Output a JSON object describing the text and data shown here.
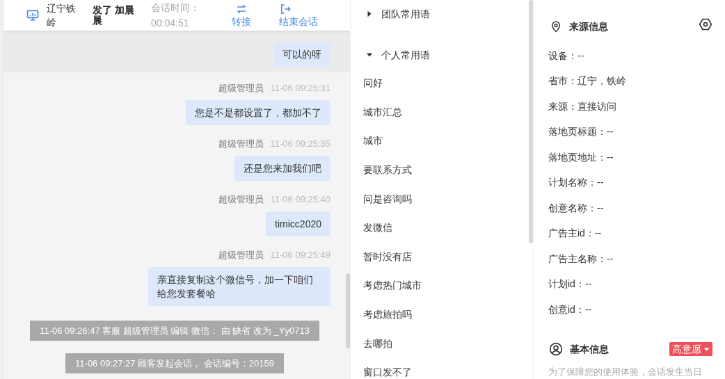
{
  "header": {
    "location": "辽宁铁岭",
    "visitor": "发了 加晨晨",
    "duration_label": "会话时间：",
    "duration": "00:04:51",
    "actions": [
      {
        "kind": "transfer",
        "label": "转接"
      },
      {
        "kind": "end",
        "label": "结束会话"
      }
    ]
  },
  "chat": {
    "messages": [
      {
        "kind": "bubble",
        "highlighted": true,
        "text": "可以的呀"
      },
      {
        "kind": "bubble",
        "highlighted": false,
        "sender": "超级管理员",
        "time": "11-06 09:25:31",
        "text": "您是不是都设置了，都加不了"
      },
      {
        "kind": "bubble",
        "highlighted": false,
        "sender": "超级管理员",
        "time": "11-06 09:25:35",
        "text": "还是您来加我们吧"
      },
      {
        "kind": "bubble",
        "highlighted": false,
        "sender": "超级管理员",
        "time": "11-06 09:25:40",
        "text": "timicc2020"
      },
      {
        "kind": "bubble",
        "highlighted": false,
        "sender": "超级管理员",
        "time": "11-06 09:25:49",
        "text": "亲直接复制这个微信号，加一下咱们给您发套餐哈"
      },
      {
        "kind": "system",
        "text": "11-06 09:26:47 客服 超级管理员 编辑 微信： 由 缺省 改为 _Yy0713"
      },
      {
        "kind": "system",
        "text": "11-06 09:27:27 顾客发起会话， 会话编号：20159"
      }
    ]
  },
  "phrases": {
    "groups": [
      {
        "label": "团队常用语",
        "expanded": false
      },
      {
        "label": "个人常用语",
        "expanded": true,
        "children": [
          "问好",
          "城市汇总",
          "城市",
          "要联系方式",
          "问是咨询吗",
          "发微信",
          "暂时没有店",
          "考虑热门城市",
          "考虑旅拍吗",
          "去哪拍",
          "窗口发不了"
        ]
      }
    ]
  },
  "source_info": {
    "title": "来源信息",
    "fields": [
      "设备：--",
      "省市：辽宁，铁岭",
      "来源：直接访问",
      "落地页标题：--",
      "落地页地址：--",
      "计划名称：--",
      "创意名称：--",
      "广告主id：--",
      "广告主名称：--",
      "计划id：--",
      "创意id：--"
    ]
  },
  "basic_info": {
    "title": "基本信息",
    "intent_tag": "高意愿",
    "hint": "为了保障您的使用体验，会话发生当日"
  }
}
